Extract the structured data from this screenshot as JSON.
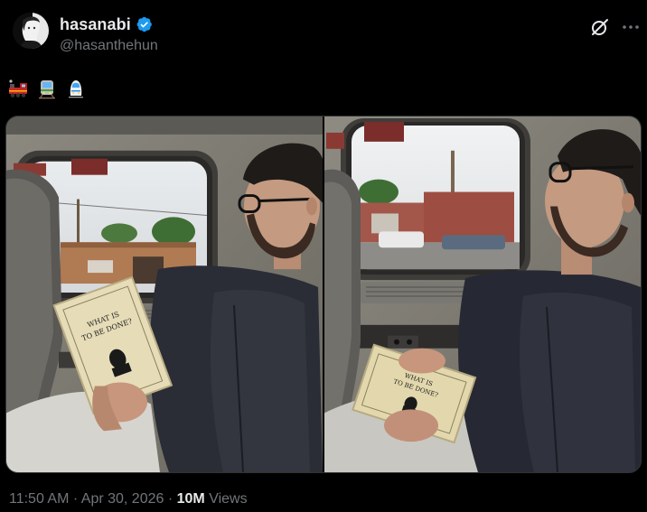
{
  "author": {
    "display_name": "hasanabi",
    "handle": "@hasanthehun",
    "verified": true,
    "verified_color": "#1d9bf0"
  },
  "tweet": {
    "emojis": [
      "steam-locomotive",
      "light-rail",
      "high-speed-train"
    ]
  },
  "media": {
    "count": 2,
    "photos": [
      {
        "name": "man-reading-book-on-train-left"
      },
      {
        "name": "man-reading-book-on-train-right"
      }
    ],
    "book_title_line1": "WHAT IS",
    "book_title_line2": "TO BE DONE?"
  },
  "meta": {
    "time": "11:50 AM",
    "separator": "·",
    "date": "Apr 30, 2026",
    "views_count": "10M",
    "views_label": "Views"
  },
  "colors": {
    "background": "#000000",
    "text_primary": "#e7e9ea",
    "text_secondary": "#71767b",
    "border": "#2f3336"
  }
}
